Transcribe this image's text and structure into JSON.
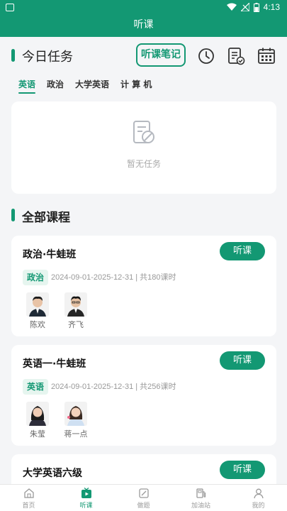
{
  "status_bar": {
    "time": "4:13"
  },
  "app_bar": {
    "title": "听课"
  },
  "today": {
    "title": "今日任务",
    "notes_button": "听课笔记",
    "tabs": [
      {
        "label": "英语",
        "active": true
      },
      {
        "label": "政治",
        "active": false
      },
      {
        "label": "大学英语",
        "active": false
      },
      {
        "label": "计 算 机",
        "active": false
      }
    ],
    "empty_text": "暂无任务"
  },
  "all_courses": {
    "title": "全部课程",
    "listen_label": "听课",
    "courses": [
      {
        "title": "政治·牛蛙班",
        "subject": "政治",
        "meta": "2024-09-01-2025-12-31 | 共180课时",
        "teachers": [
          "陈欢",
          "齐飞"
        ]
      },
      {
        "title": "英语一·牛蛙班",
        "subject": "英语",
        "meta": "2024-09-01-2025-12-31 | 共256课时",
        "teachers": [
          "朱莹",
          "蒋一点"
        ]
      },
      {
        "title": "大学英语六级"
      }
    ]
  },
  "bottom_nav": [
    {
      "label": "首页",
      "icon": "home-icon"
    },
    {
      "label": "听课",
      "icon": "play-icon",
      "active": true
    },
    {
      "label": "做题",
      "icon": "edit-icon"
    },
    {
      "label": "加油站",
      "icon": "station-icon"
    },
    {
      "label": "我的",
      "icon": "user-icon"
    }
  ],
  "colors": {
    "brand": "#139873",
    "tag_bg": "#e6f5ef",
    "background": "#f4f5f7"
  }
}
